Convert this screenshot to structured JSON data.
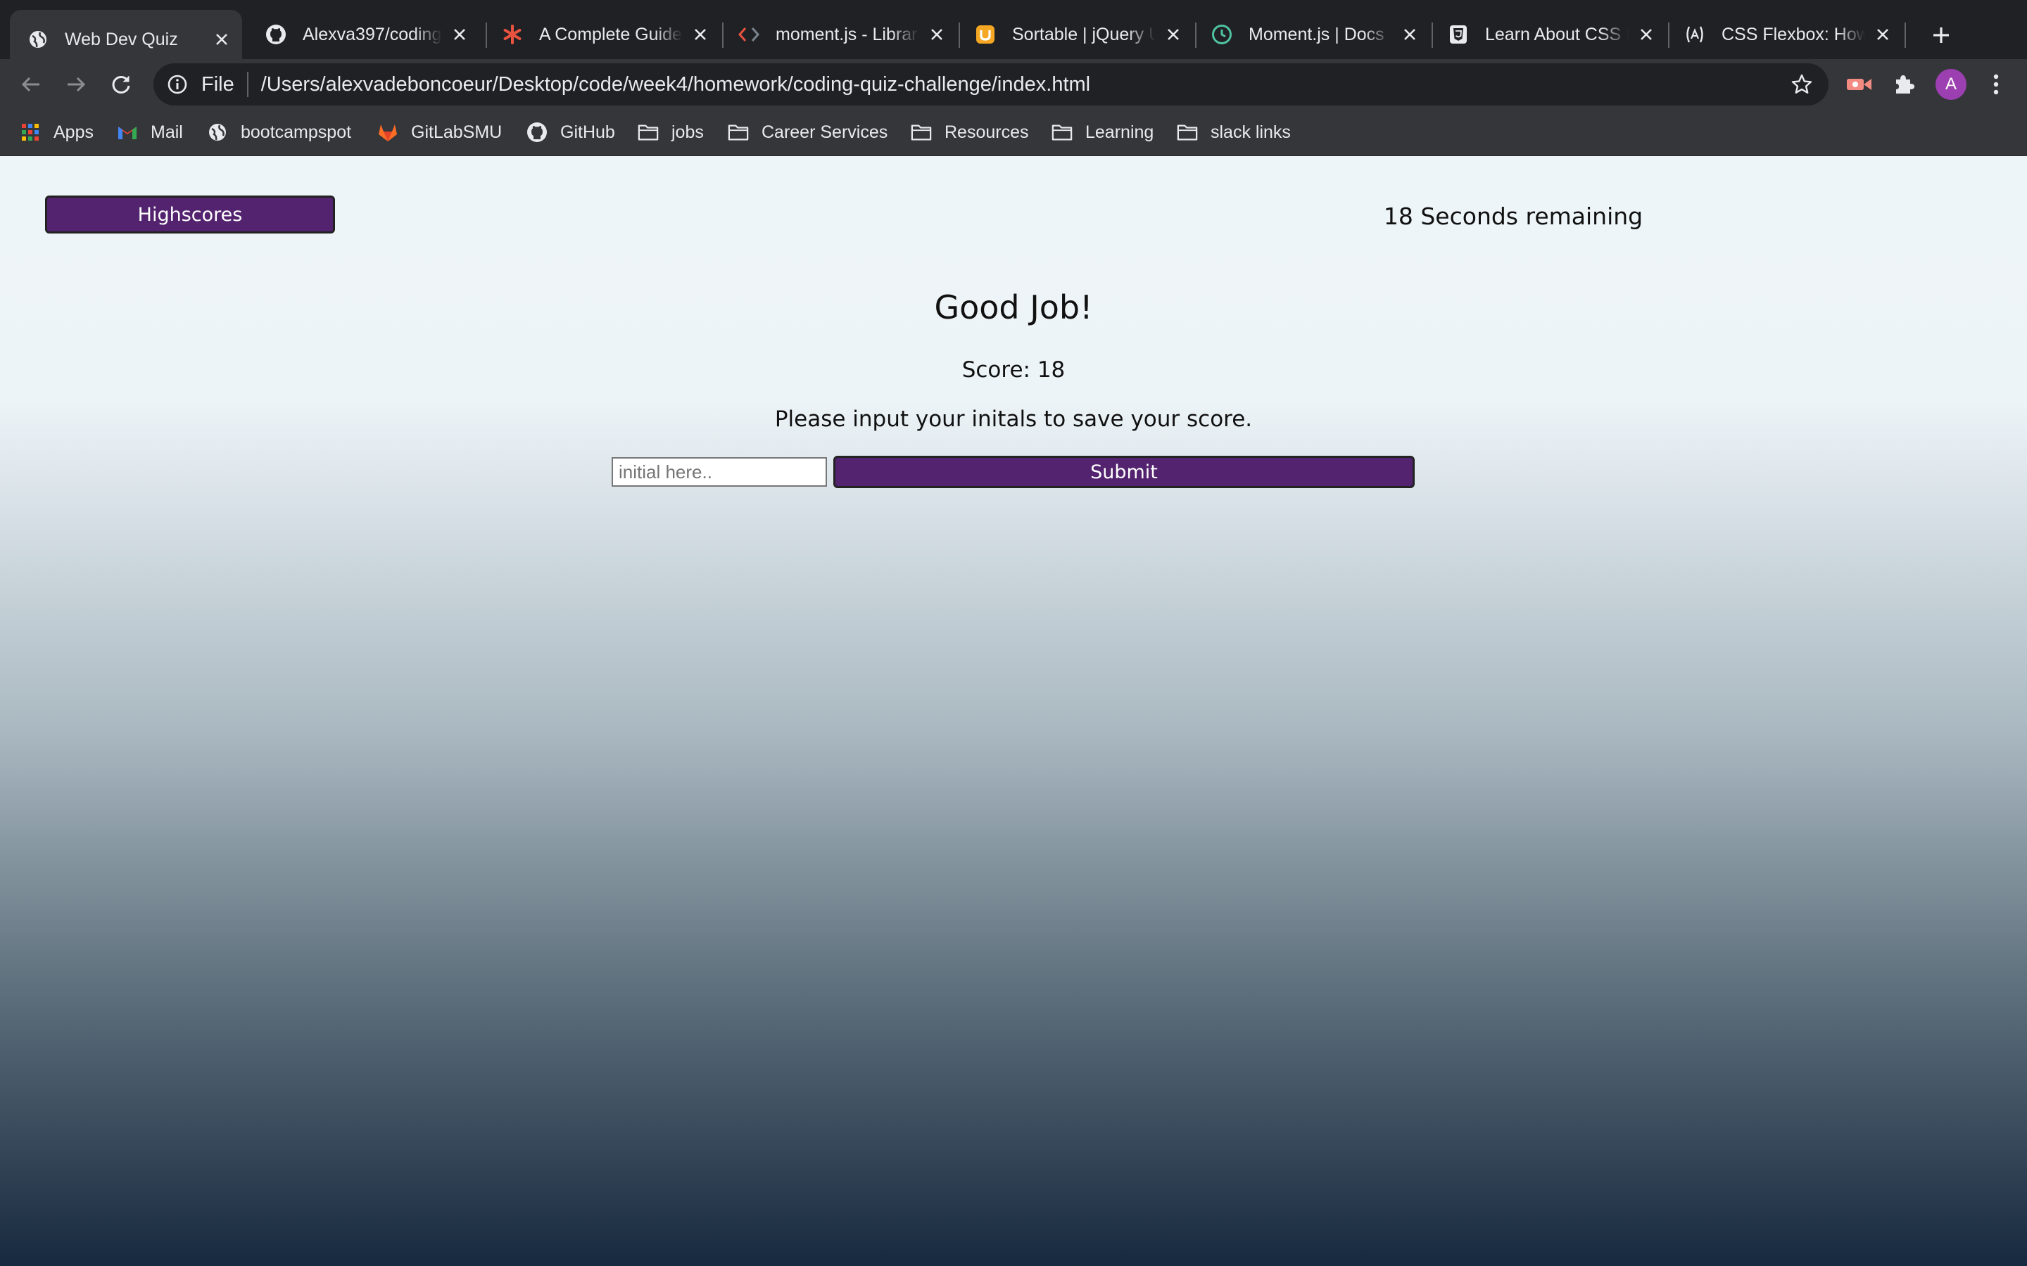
{
  "browser": {
    "tabs": [
      {
        "title": "Web Dev Quiz",
        "icon": "globe-icon",
        "active": true
      },
      {
        "title": "Alexva397/coding",
        "icon": "github-icon",
        "active": false
      },
      {
        "title": "A Complete Guide",
        "icon": "asterisk-icon",
        "active": false
      },
      {
        "title": "moment.js - Librar",
        "icon": "code-brackets-icon",
        "active": false
      },
      {
        "title": "Sortable | jQuery U",
        "icon": "jquery-ui-icon",
        "active": false
      },
      {
        "title": "Moment.js | Docs",
        "icon": "clock-icon",
        "active": false
      },
      {
        "title": "Learn About CSS L",
        "icon": "css-shield-icon",
        "active": false
      },
      {
        "title": "CSS Flexbox: How",
        "icon": "dev-logo-icon",
        "active": false
      }
    ],
    "address": {
      "scheme": "File",
      "url": "/Users/alexvadeboncoeur/Desktop/code/week4/homework/coding-quiz-challenge/index.html"
    },
    "profile_initial": "A",
    "bookmarks": [
      {
        "label": "Apps",
        "icon": "apps-grid-icon"
      },
      {
        "label": "Mail",
        "icon": "gmail-icon"
      },
      {
        "label": "bootcampspot",
        "icon": "globe-icon"
      },
      {
        "label": "GitLabSMU",
        "icon": "gitlab-icon"
      },
      {
        "label": "GitHub",
        "icon": "github-icon"
      },
      {
        "label": "jobs",
        "icon": "folder-icon"
      },
      {
        "label": "Career Services",
        "icon": "folder-icon"
      },
      {
        "label": "Resources",
        "icon": "folder-icon"
      },
      {
        "label": "Learning",
        "icon": "folder-icon"
      },
      {
        "label": "slack links",
        "icon": "folder-icon"
      }
    ]
  },
  "quiz": {
    "highscores_label": "Highscores",
    "timer_text": "18 Seconds remaining",
    "heading": "Good Job!",
    "score_text": "Score: 18",
    "prompt": "Please input your initals to save your score.",
    "initials_placeholder": "initial here..",
    "initials_value": "",
    "submit_label": "Submit"
  },
  "colors": {
    "button_purple": "#53236f",
    "page_top": "#eef5f9",
    "page_bottom": "#17293e",
    "chrome_dark": "#202124",
    "chrome_toolbar": "#35363a",
    "avatar": "#9c3fb0"
  }
}
